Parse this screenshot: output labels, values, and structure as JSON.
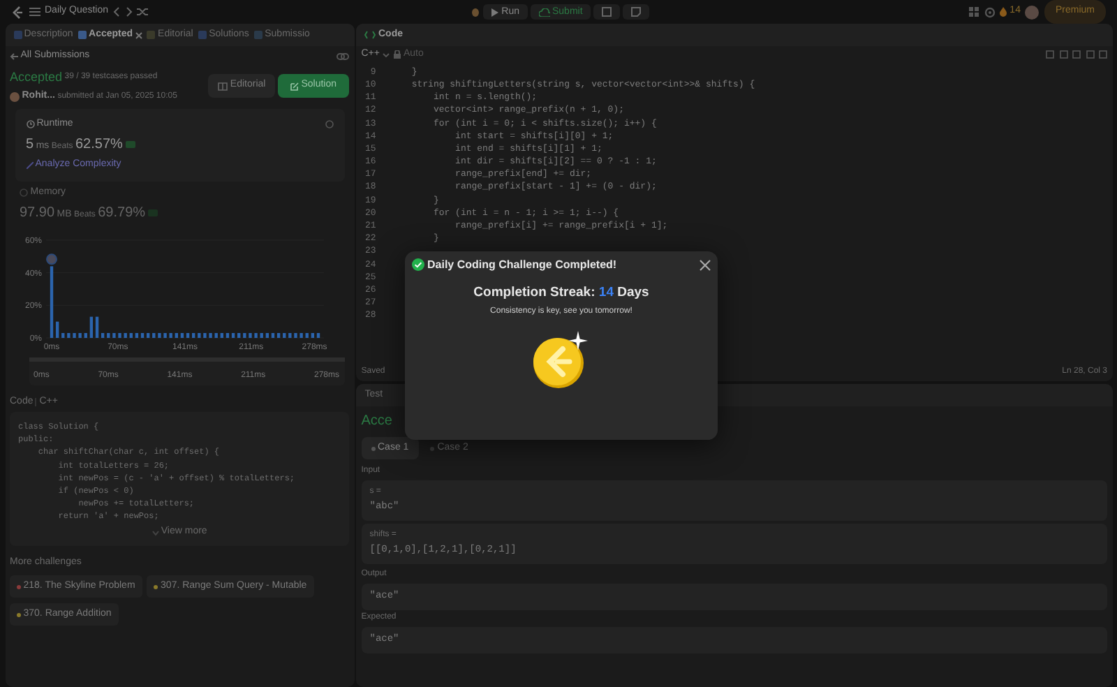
{
  "top_bar": {
    "title": "Daily Question",
    "run": "Run",
    "submit": "Submit",
    "streak": "14",
    "premium": "Premium"
  },
  "left_tabs": [
    {
      "label": "Description",
      "selected": false,
      "closable": false
    },
    {
      "label": "Accepted",
      "selected": true,
      "closable": true
    },
    {
      "label": "Editorial",
      "selected": false,
      "closable": false
    },
    {
      "label": "Solutions",
      "selected": false,
      "closable": false
    },
    {
      "label": "Submissio",
      "selected": false,
      "closable": false
    }
  ],
  "back_link": "All Submissions",
  "submission": {
    "status": "Accepted",
    "passed": "39 / 39 testcases passed",
    "user": "Rohit...",
    "submitted": "submitted at Jan 05, 2025 10:05",
    "editorial": "Editorial",
    "solution": "Solution"
  },
  "runtime": {
    "title": "Runtime",
    "value": "5",
    "unit": "ms",
    "beats_label": "Beats",
    "beats": "62.57%",
    "analyze": "Analyze Complexity"
  },
  "memory": {
    "title": "Memory",
    "value": "97.90",
    "unit": "MB",
    "beats_label": "Beats",
    "beats": "69.79%"
  },
  "chart_data": {
    "type": "bar",
    "x": [
      0,
      6,
      12,
      18,
      24,
      30,
      36,
      42,
      48,
      54,
      60,
      66,
      72,
      78,
      84,
      90,
      96,
      102,
      108,
      114,
      120,
      126,
      132,
      138,
      144,
      150,
      156,
      162,
      168,
      174,
      180,
      186,
      192,
      198,
      204,
      210,
      216,
      222,
      228,
      234,
      240,
      246,
      252,
      258,
      264,
      270,
      276,
      282
    ],
    "series": [
      {
        "color": "#2b64ad",
        "values": [
          44,
          10,
          3,
          3,
          3,
          3,
          3,
          13,
          13,
          3,
          3,
          3,
          3,
          3,
          3,
          3,
          3,
          3,
          3,
          3,
          3,
          3,
          3,
          3,
          3,
          3,
          3,
          3,
          3,
          3,
          3,
          3,
          3,
          3,
          3,
          3,
          3,
          3,
          3,
          3,
          3,
          3,
          3,
          3,
          3,
          3,
          3,
          3
        ]
      }
    ],
    "xlim": [
      0,
      282
    ],
    "ylim": [
      0,
      60
    ],
    "xticks": [
      {
        "value": 0,
        "label": "0ms"
      },
      {
        "value": 70,
        "label": "70ms"
      },
      {
        "value": 141,
        "label": "141ms"
      },
      {
        "value": 211,
        "label": "211ms"
      },
      {
        "value": 278,
        "label": "278ms"
      }
    ],
    "yticks": [
      {
        "value": 0,
        "label": "0%"
      },
      {
        "value": 20,
        "label": "20%"
      },
      {
        "value": 40,
        "label": "40%"
      },
      {
        "value": 60,
        "label": "60%"
      }
    ]
  },
  "range_slider": {
    "labels": [
      "0ms",
      "70ms",
      "141ms",
      "211ms",
      "278ms"
    ],
    "level": 1
  },
  "code_section": {
    "title": "Code",
    "language": "C++",
    "lines": [
      "class Solution {",
      "public:",
      "    char shiftChar(char c, int offset) {",
      "        int totalLetters = 26;",
      "        int newPos = (c - 'a' + offset) % totalLetters;",
      "        if (newPos < 0)",
      "            newPos += totalLetters;",
      "        return 'a' + newPos;"
    ],
    "view_more": "View more"
  },
  "more_challenges": {
    "title": "More challenges",
    "items": [
      {
        "label": "218. The Skyline Problem",
        "color": "#8a3a3a"
      },
      {
        "label": "307. Range Sum Query - Mutable",
        "color": "#8a7a2a"
      },
      {
        "label": "370. Range Addition",
        "color": "#8a7a2a"
      }
    ]
  },
  "editor": {
    "tab": "Code",
    "language": "C++",
    "mode": "Auto",
    "status": "Saved",
    "position": "Ln 28, Col 3",
    "lines": [
      {
        "number": "9",
        "code": "    }"
      },
      {
        "number": "10",
        "code": "    string shiftingLetters(string s, vector<vector<int>>& shifts) {"
      },
      {
        "number": "11",
        "code": "        int n = s.length();"
      },
      {
        "number": "12",
        "code": "        vector<int> range_prefix(n + 1, 0);"
      },
      {
        "number": "13",
        "code": "        for (int i = 0; i < shifts.size(); i++) {"
      },
      {
        "number": "14",
        "code": "            int start = shifts[i][0] + 1;"
      },
      {
        "number": "15",
        "code": "            int end = shifts[i][1] + 1;"
      },
      {
        "number": "16",
        "code": "            int dir = shifts[i][2] == 0 ? -1 : 1;"
      },
      {
        "number": "17",
        "code": "            range_prefix[end] += dir;"
      },
      {
        "number": "18",
        "code": "            range_prefix[start - 1] += (0 - dir);"
      },
      {
        "number": "19",
        "code": "        }"
      },
      {
        "number": "20",
        "code": "        for (int i = n - 1; i >= 1; i--) {"
      },
      {
        "number": "21",
        "code": "            range_prefix[i] += range_prefix[i + 1];"
      },
      {
        "number": "22",
        "code": "        }"
      },
      {
        "number": "23"
      },
      {
        "number": "24"
      },
      {
        "number": "25"
      },
      {
        "number": "26"
      },
      {
        "number": "27"
      },
      {
        "number": "28"
      }
    ]
  },
  "test_panel": {
    "tab": "Test",
    "result": "Acce",
    "cases": [
      {
        "label": "Case 1",
        "selected": true
      },
      {
        "label": "Case 2",
        "selected": false
      }
    ],
    "input_label": "Input",
    "inputs": [
      {
        "name": "s =",
        "value": "\"abc\""
      },
      {
        "name": "shifts =",
        "value": "[[0,1,0],[1,2,1],[0,2,1]]"
      }
    ],
    "output_label": "Output",
    "output": "\"ace\"",
    "expected_label": "Expected",
    "expected": "\"ace\""
  },
  "dialog": {
    "title": "Daily Coding Challenge Completed!",
    "streak_label": "Completion Streak:",
    "streak": "14",
    "streak_unit": "Days",
    "message": "Consistency is key, see you tomorrow!"
  }
}
